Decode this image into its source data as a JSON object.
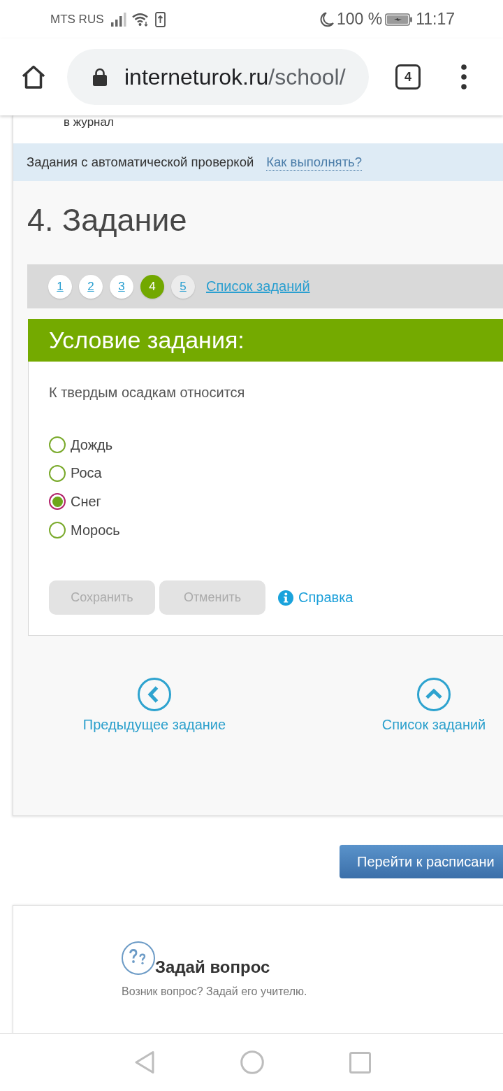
{
  "status_bar": {
    "carrier": "MTS RUS",
    "battery": "100 %",
    "time": "11:17"
  },
  "browser": {
    "url_host": "interneturok.ru",
    "url_path": "/school/",
    "tab_count": "4"
  },
  "page": {
    "journal_link": "в журнал",
    "info_bar": {
      "text": "Задания с автоматической проверкой",
      "link": "Как выполнять?"
    },
    "heading": "4. Задание",
    "pagination": {
      "pages": [
        {
          "label": "1",
          "selected": false,
          "visited": true
        },
        {
          "label": "2",
          "selected": false,
          "visited": true
        },
        {
          "label": "3",
          "selected": false,
          "visited": true
        },
        {
          "label": "4",
          "selected": true
        },
        {
          "label": "5",
          "selected": false,
          "visited": false
        }
      ],
      "list_link": "Список заданий"
    },
    "task": {
      "title": "Условие задания:",
      "question": "К твердым осадкам относится",
      "options": [
        {
          "label": "Дождь",
          "selected": false
        },
        {
          "label": "Роса",
          "selected": false
        },
        {
          "label": "Снег",
          "selected": true
        },
        {
          "label": "Морось",
          "selected": false
        }
      ],
      "buttons": [
        {
          "label": "Сохранить",
          "disabled": true
        },
        {
          "label": "Отменить",
          "disabled": true
        }
      ],
      "help_link": "Справка"
    },
    "navigation": [
      {
        "kind": "previous",
        "label": "Предыдущее задание"
      },
      {
        "kind": "list",
        "label": "Список заданий"
      }
    ],
    "schedule_button": "Перейти к расписани",
    "ask": {
      "title": "Задай вопрос",
      "text": "Возник вопрос? Задай его учителю."
    }
  }
}
